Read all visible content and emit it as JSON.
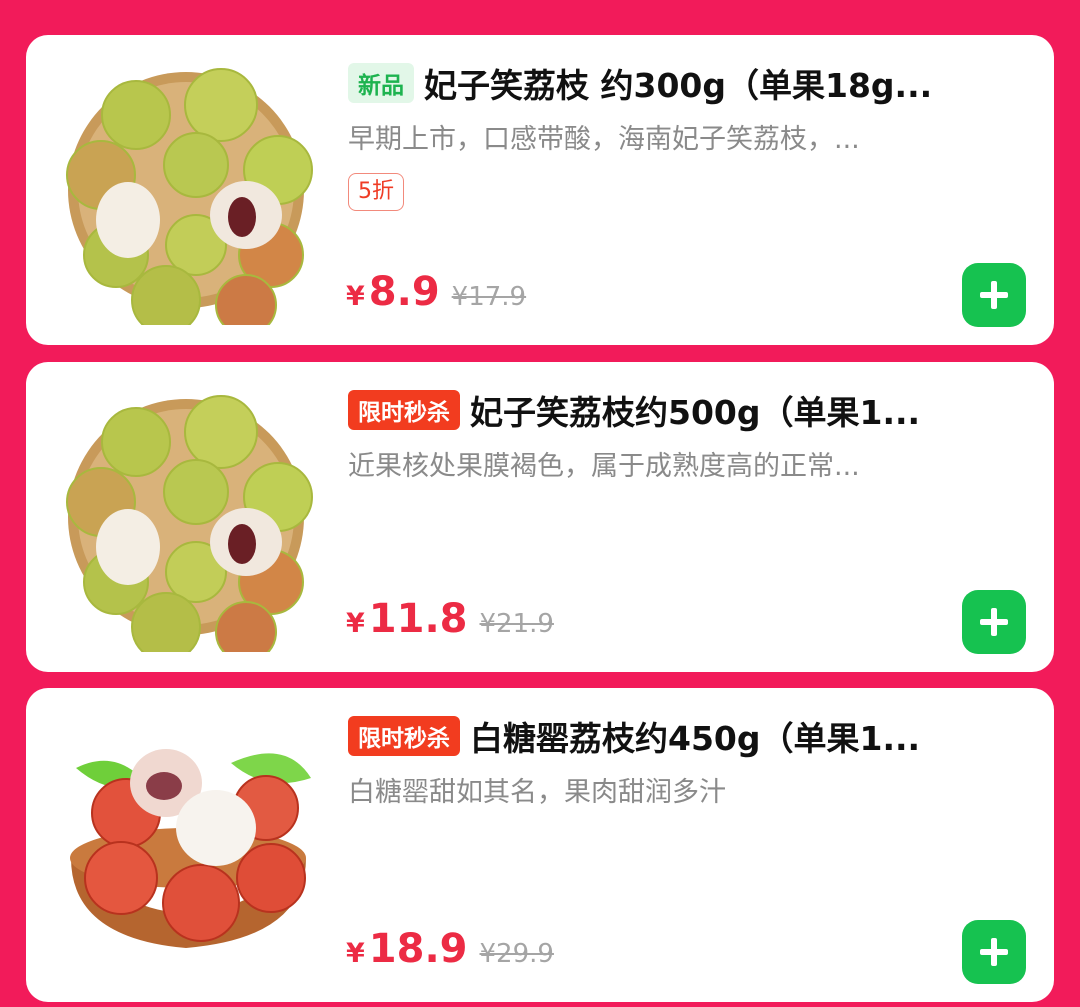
{
  "products": [
    {
      "tag": "新品",
      "title": "妃子笑荔枝 约300g（单果18g...",
      "desc": "早期上市，口感带酸，海南妃子笑荔枝，...",
      "discount": "5折",
      "currency": "¥",
      "price": "8.9",
      "original_price": "¥17.9",
      "image": "green-lychee-bowl"
    },
    {
      "tag": "限时秒杀",
      "title": "妃子笑荔枝约500g（单果1...",
      "desc": "近果核处果膜褐色，属于成熟度高的正常...",
      "currency": "¥",
      "price": "11.8",
      "original_price": "¥21.9",
      "image": "green-lychee-bowl"
    },
    {
      "tag": "限时秒杀",
      "title": "白糖罂荔枝约450g（单果1...",
      "desc": "白糖罂甜如其名，果肉甜润多汁",
      "currency": "¥",
      "price": "18.9",
      "original_price": "¥29.9",
      "image": "red-lychee-bowl"
    }
  ],
  "icons": {
    "add": "plus-icon"
  },
  "colors": {
    "background": "#f21b5a",
    "price": "#ec2b44",
    "add_button": "#16c250",
    "tag_new_bg": "#e2f7e8",
    "tag_new_text": "#1db34f",
    "tag_flash_bg": "#f23c1f"
  }
}
